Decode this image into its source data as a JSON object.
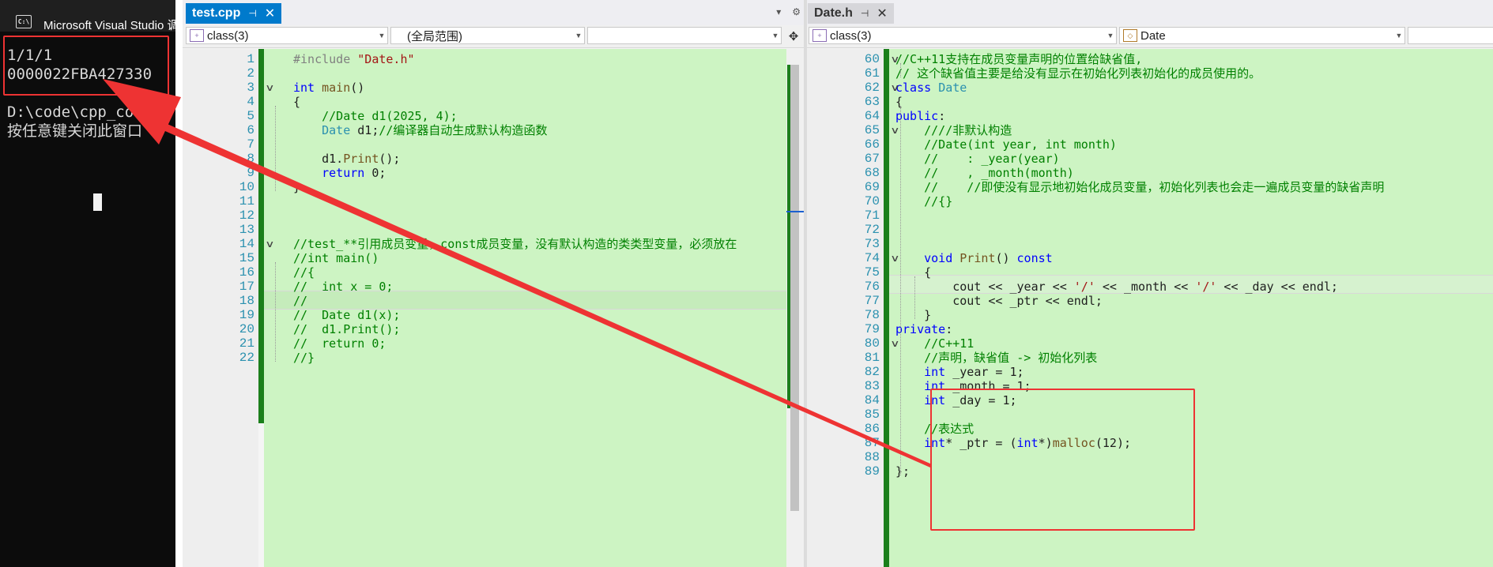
{
  "console": {
    "title": "Microsoft Visual Studio 调",
    "app_icon": "C:\\",
    "output_lines": [
      "1/1/1",
      "0000022FBA427330",
      "",
      "D:\\code\\cpp_code",
      "按任意键关闭此窗口"
    ]
  },
  "left_editor": {
    "tab": {
      "name": "test.cpp",
      "pin_icon": "pin-icon",
      "close_icon": "close-icon"
    },
    "nav": {
      "project": "class(3)",
      "scope": "(全局范围)",
      "member": ""
    },
    "lines": [
      {
        "n": "1",
        "code": "#include \"Date.h\""
      },
      {
        "n": "2",
        "code": ""
      },
      {
        "n": "3",
        "code": "int main()"
      },
      {
        "n": "4",
        "code": "{"
      },
      {
        "n": "5",
        "code": "    //Date d1(2025, 4);"
      },
      {
        "n": "6",
        "code": "    Date d1;//编译器自动生成默认构造函数"
      },
      {
        "n": "7",
        "code": ""
      },
      {
        "n": "8",
        "code": "    d1.Print();"
      },
      {
        "n": "9",
        "code": "    return 0;"
      },
      {
        "n": "10",
        "code": "}"
      },
      {
        "n": "11",
        "code": ""
      },
      {
        "n": "12",
        "code": ""
      },
      {
        "n": "13",
        "code": ""
      },
      {
        "n": "14",
        "code": "//test_**引用成员变量，const成员变量，没有默认构造的类类型变量，必须放在"
      },
      {
        "n": "15",
        "code": "//int main()"
      },
      {
        "n": "16",
        "code": "//{"
      },
      {
        "n": "17",
        "code": "//  int x = 0;"
      },
      {
        "n": "18",
        "code": "//"
      },
      {
        "n": "19",
        "code": "//  Date d1(x);"
      },
      {
        "n": "20",
        "code": "//  d1.Print();"
      },
      {
        "n": "21",
        "code": "//  return 0;"
      },
      {
        "n": "22",
        "code": "//}"
      }
    ]
  },
  "right_editor": {
    "tab": {
      "name": "Date.h",
      "pin_icon": "pin-icon",
      "close_icon": "close-icon"
    },
    "nav": {
      "project": "class(3)",
      "scope": "Date",
      "member": ""
    },
    "lines": [
      {
        "n": "60",
        "code": "//C++11支持在成员变量声明的位置给缺省值,"
      },
      {
        "n": "61",
        "code": "// 这个缺省值主要是给没有显示在初始化列表初始化的成员使用的。"
      },
      {
        "n": "62",
        "code": "class Date"
      },
      {
        "n": "63",
        "code": "{"
      },
      {
        "n": "64",
        "code": "public:"
      },
      {
        "n": "65",
        "code": "    ////非默认构造"
      },
      {
        "n": "66",
        "code": "    //Date(int year, int month)"
      },
      {
        "n": "67",
        "code": "    //    : _year(year)"
      },
      {
        "n": "68",
        "code": "    //    , _month(month)"
      },
      {
        "n": "69",
        "code": "    //    //即使没有显示地初始化成员变量，初始化列表也会走一遍成员变量的缺省声明"
      },
      {
        "n": "70",
        "code": "    //{}"
      },
      {
        "n": "71",
        "code": ""
      },
      {
        "n": "72",
        "code": ""
      },
      {
        "n": "73",
        "code": ""
      },
      {
        "n": "74",
        "code": "    void Print() const"
      },
      {
        "n": "75",
        "code": "    {"
      },
      {
        "n": "76",
        "code": "        cout << _year << '/' << _month << '/' << _day << endl;"
      },
      {
        "n": "77",
        "code": "        cout << _ptr << endl;"
      },
      {
        "n": "78",
        "code": "    }"
      },
      {
        "n": "79",
        "code": "private:"
      },
      {
        "n": "80",
        "code": "    //C++11"
      },
      {
        "n": "81",
        "code": "    //声明，缺省值 -> 初始化列表"
      },
      {
        "n": "82",
        "code": "    int _year = 1;"
      },
      {
        "n": "83",
        "code": "    int _month = 1;"
      },
      {
        "n": "84",
        "code": "    int _day = 1;"
      },
      {
        "n": "85",
        "code": ""
      },
      {
        "n": "86",
        "code": "    //表达式"
      },
      {
        "n": "87",
        "code": "    int* _ptr = (int*)malloc(12);"
      },
      {
        "n": "88",
        "code": ""
      },
      {
        "n": "89",
        "code": "};"
      }
    ]
  },
  "colors": {
    "code_bg": "#cdf4c3",
    "annotation_red": "#ee3333",
    "tab_active": "#007acc",
    "changebar": "#1b7f1b"
  }
}
